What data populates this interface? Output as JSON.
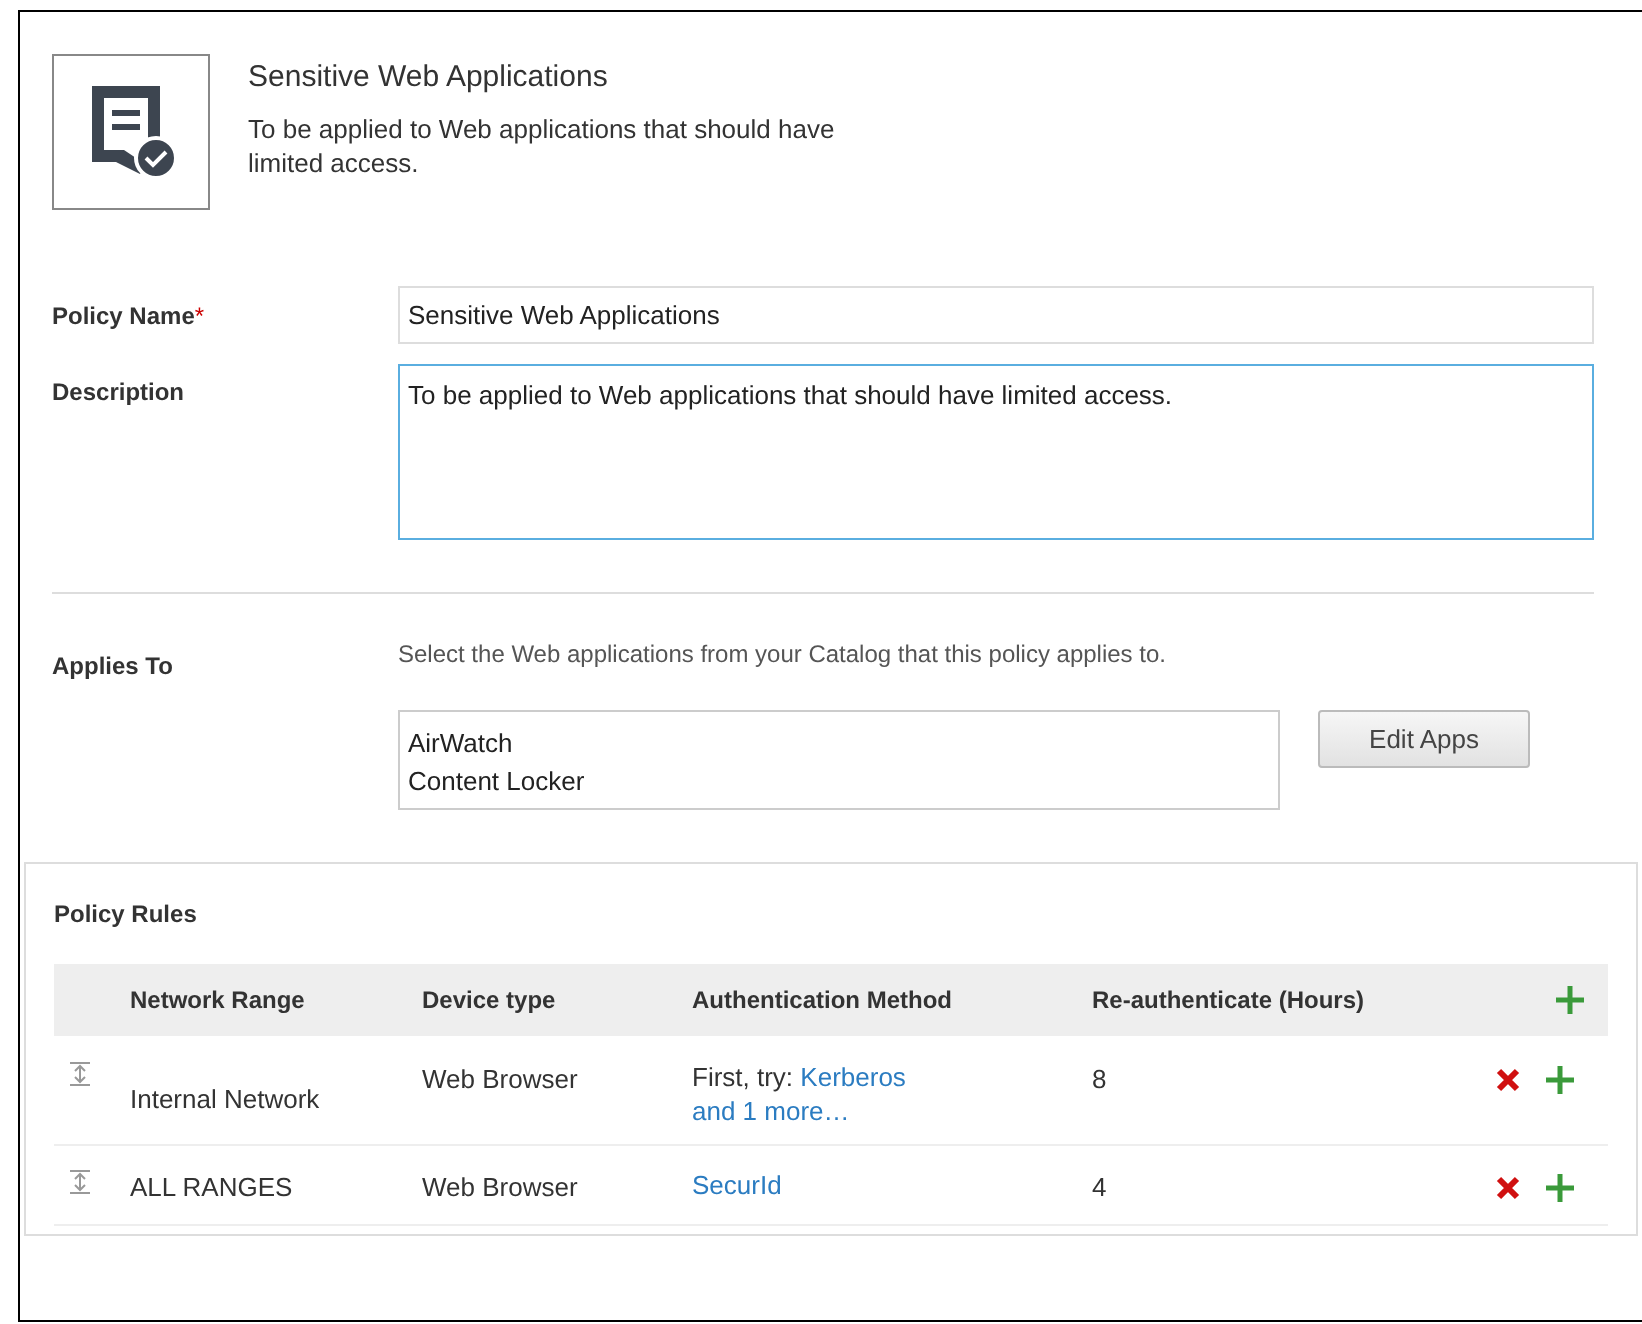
{
  "header": {
    "title": "Sensitive Web Applications",
    "subtitle": "To be applied to Web applications that should have limited access."
  },
  "form": {
    "policy_name": {
      "label": "Policy Name",
      "required_mark": "*",
      "value": "Sensitive Web Applications"
    },
    "description": {
      "label": "Description",
      "value": "To be applied to Web applications that should have limited access.",
      "focused": true
    },
    "applies_to": {
      "label": "Applies To",
      "hint": "Select the Web applications from your Catalog that this policy applies to.",
      "apps": [
        "AirWatch",
        "Content Locker"
      ],
      "button": "Edit Apps"
    }
  },
  "policy_rules": {
    "title": "Policy Rules",
    "columns": [
      "Network Range",
      "Device type",
      "Authentication Method",
      "Re-authenticate (Hours)"
    ],
    "rows": [
      {
        "network_range": "Internal Network",
        "device_type": "Web Browser",
        "method": [
          {
            "kind": "text",
            "text": "First, try:"
          },
          {
            "kind": "link",
            "text": "Kerberos"
          },
          {
            "kind": "link",
            "text": "and 1 more…"
          }
        ],
        "hours": "8"
      },
      {
        "network_range": "ALL RANGES",
        "device_type": "Web Browser",
        "method": [
          {
            "kind": "link",
            "text": "SecurId"
          }
        ],
        "hours": "4"
      }
    ]
  }
}
